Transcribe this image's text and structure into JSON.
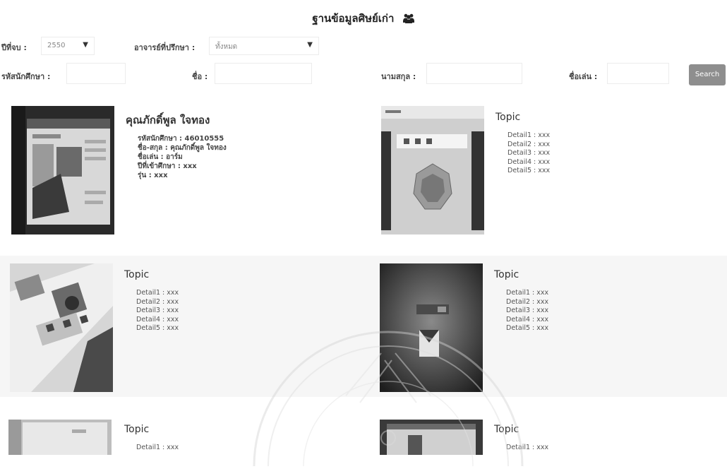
{
  "page": {
    "title": "ฐานข้อมูลศิษย์เก่า"
  },
  "icons": {
    "title_icon": "users-icon",
    "caret": "chevron-down-icon"
  },
  "colors": {
    "search_button_bg": "#8e8e8e",
    "band_gray": "#f6f6f6"
  },
  "filters": {
    "year_label": "ปีที่จบ :",
    "year_value": "2550",
    "advisor_label": "อาจารย์ที่ปรึกษา :",
    "advisor_value": "ทั้งหมด",
    "student_id_label": "รหัสนักศึกษา :",
    "first_name_label": "ชื่อ :",
    "last_name_label": "นามสกุล :",
    "nickname_label": "ชื่อเล่น :",
    "search_label": "Search"
  },
  "cards": [
    {
      "title": "คุณภักดิ์พูล ใจทอง",
      "details": [
        "รหัสนักศึกษา : 46010555",
        "ชื่อ-สกุล : คุณภักดิ์พูล ใจทอง",
        "ชื่อเล่น : อาร์ม",
        "ปีที่เข้าศึกษา : xxx",
        "รุ่น : xxx"
      ]
    },
    {
      "title": "Topic",
      "details": [
        "Detail1 : xxx",
        "Detail2 : xxx",
        "Detail3 : xxx",
        "Detail4 : xxx",
        "Detail5 : xxx"
      ]
    },
    {
      "title": "Topic",
      "details": [
        "Detail1 : xxx",
        "Detail2 : xxx",
        "Detail3 : xxx",
        "Detail4 : xxx",
        "Detail5 : xxx"
      ]
    },
    {
      "title": "Topic",
      "details": [
        "Detail1 : xxx",
        "Detail2 : xxx",
        "Detail3 : xxx",
        "Detail4 : xxx",
        "Detail5 : xxx"
      ]
    },
    {
      "title": "Topic",
      "details": [
        "Detail1 : xxx"
      ]
    },
    {
      "title": "Topic",
      "details": [
        "Detail1 : xxx"
      ]
    }
  ]
}
